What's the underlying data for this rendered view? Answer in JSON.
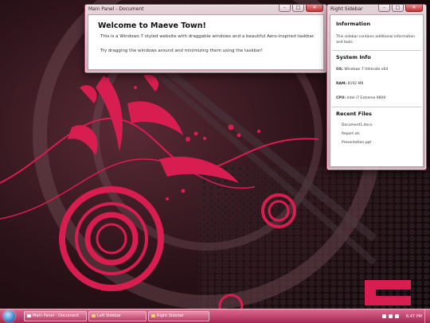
{
  "main_panel": {
    "title": "Main Panel - Document",
    "heading": "Welcome to Maeve Town!",
    "paragraph1": "This is a Windows 7 styled website with draggable windows and a beautiful Aero-inspired taskbar.",
    "paragraph2": "Try dragging the windows around and minimizing them using the taskbar!"
  },
  "right_sidebar": {
    "title": "Right Sidebar",
    "information_heading": "Information",
    "information_text": "This sidebar contains additional information and tools.",
    "system_heading": "System Info",
    "os_label": "OS:",
    "os_value": "Windows 7 Ultimate x64",
    "ram_label": "RAM:",
    "ram_value": "8192 MB",
    "cpu_label": "CPU:",
    "cpu_value": "Intel i7 Extreme 9809",
    "files_heading": "Recent Files",
    "files": [
      "Document1.docx",
      "Report.xls",
      "Presentation.ppt"
    ]
  },
  "window_controls": {
    "minimize": "–",
    "maximize": "□",
    "close": "✕"
  },
  "taskbar": {
    "items": [
      {
        "label": "Main Panel - Document",
        "icon": "document-icon"
      },
      {
        "label": "Left Sidebar",
        "icon": "folder-icon"
      },
      {
        "label": "Right Sidebar",
        "icon": "folder-icon"
      }
    ],
    "clock": "6:47 PM"
  },
  "colors": {
    "accent": "#c2245a",
    "taskbar_top": "#e66e96",
    "taskbar_bottom": "#aa2855",
    "wallpaper_red": "#d81e50"
  }
}
